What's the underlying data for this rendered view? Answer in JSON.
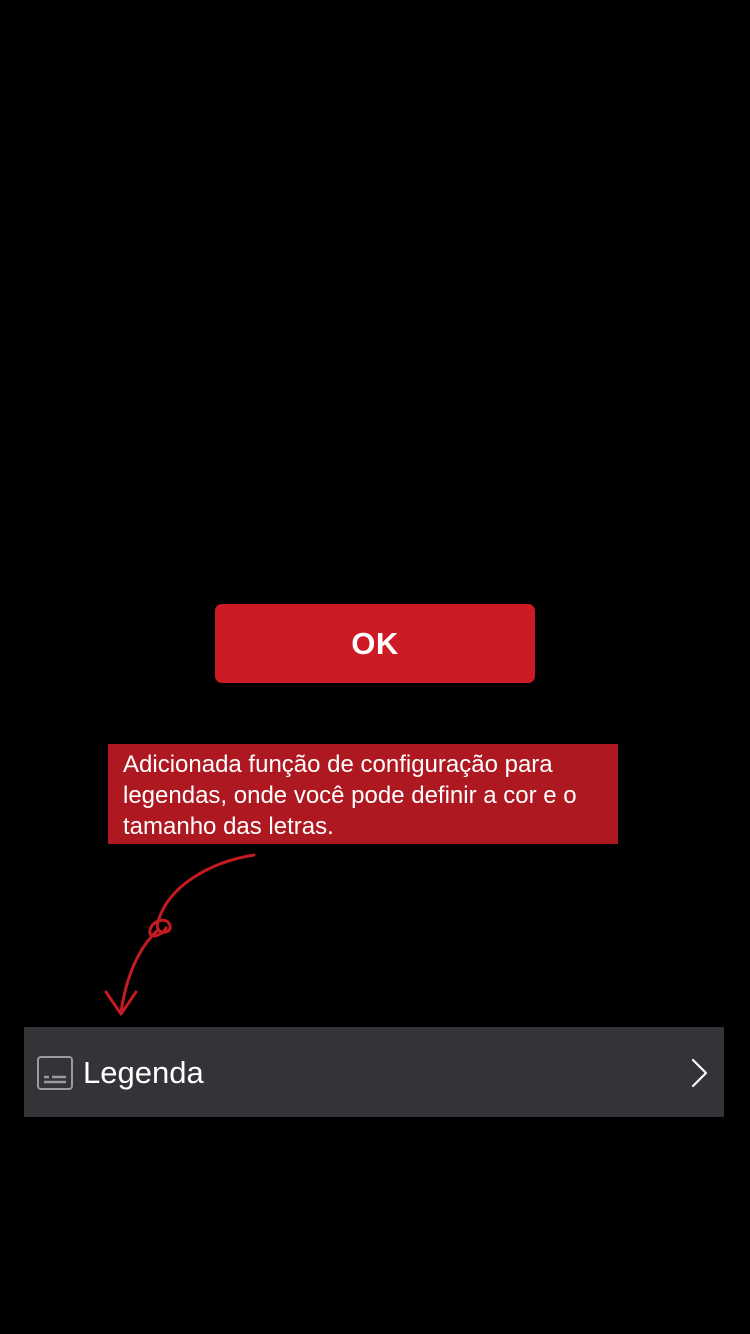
{
  "ok_button": {
    "label": "OK",
    "color": "#cc1b24"
  },
  "tip": {
    "text": "Adicionada função de configuração para legendas, onde você pode definir a cor e o tamanho das letras.",
    "background": "#ae1820"
  },
  "arrow": {
    "icon": "hand-drawn-arrow-icon",
    "color": "#c41a22"
  },
  "settings_row": {
    "icon": "subtitles-icon",
    "label": "Legenda",
    "trailing_icon": "chevron-right-icon",
    "background": "#333338"
  }
}
